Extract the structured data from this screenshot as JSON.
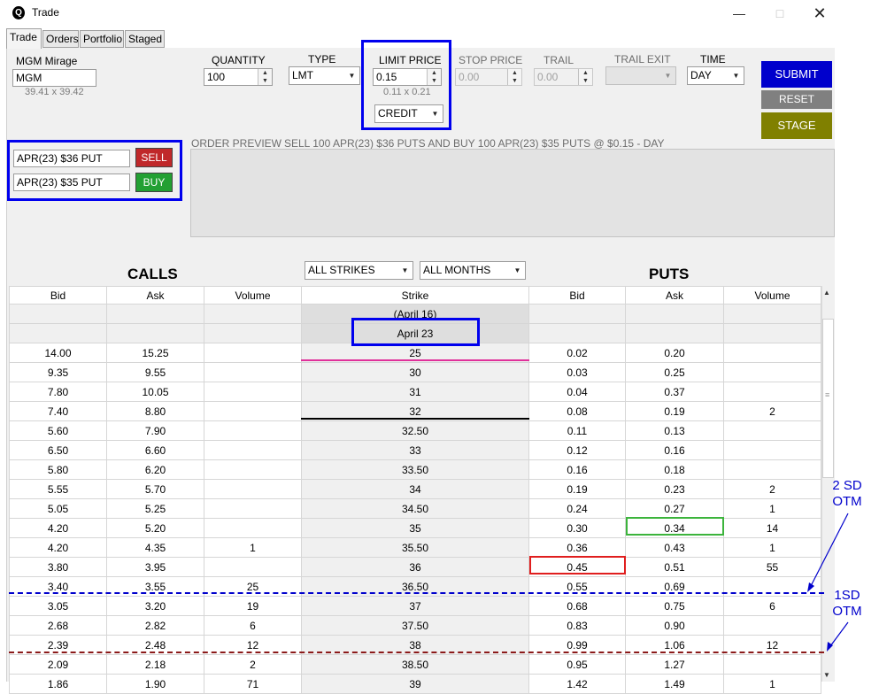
{
  "window": {
    "title": "Trade",
    "app_icon": "Q"
  },
  "tabs": [
    {
      "label": "Trade",
      "active": true
    },
    {
      "label": "Orders",
      "active": false
    },
    {
      "label": "Portfolio",
      "active": false
    },
    {
      "label": "Staged",
      "active": false
    }
  ],
  "symbol": {
    "name": "MGM Mirage",
    "ticker": "MGM",
    "quote": "39.41 x 39.42"
  },
  "order": {
    "quantity_label": "QUANTITY",
    "quantity": "100",
    "type_label": "TYPE",
    "type": "LMT",
    "limit_label": "LIMIT PRICE",
    "limit": "0.15",
    "limit_range": "0.11 x 0.21",
    "credit": "CREDIT",
    "stop_label": "STOP PRICE",
    "stop": "0.00",
    "trail_label": "TRAIL",
    "trail": "0.00",
    "trail_exit_label": "TRAIL EXIT",
    "trail_exit": "",
    "time_label": "TIME",
    "time": "DAY"
  },
  "actions": {
    "submit": "SUBMIT",
    "reset": "RESET",
    "stage": "STAGE",
    "submit_color": "#0000cc",
    "reset_color": "#808080",
    "stage_color": "#808000"
  },
  "legs": [
    {
      "desc": "APR(23) $36 PUT",
      "action": "SELL",
      "color": "#c0282a"
    },
    {
      "desc": "APR(23) $35 PUT",
      "action": "BUY",
      "color": "#23a033"
    }
  ],
  "preview": {
    "label": "ORDER PREVIEW",
    "text": "SELL 100 APR(23) $36 PUTS AND BUY 100 APR(23) $35 PUTS @ $0.15 - DAY"
  },
  "chain": {
    "calls_label": "CALLS",
    "puts_label": "PUTS",
    "strikes_filter": "ALL STRIKES",
    "months_filter": "ALL MONTHS",
    "headers": [
      "Bid",
      "Ask",
      "Volume",
      "Strike",
      "Bid",
      "Ask",
      "Volume"
    ],
    "month_rows": [
      "(April 16)",
      "April 23"
    ],
    "rows": [
      [
        "14.00",
        "15.25",
        "",
        "25",
        "0.02",
        "0.20",
        ""
      ],
      [
        "9.35",
        "9.55",
        "",
        "30",
        "0.03",
        "0.25",
        ""
      ],
      [
        "7.80",
        "10.05",
        "",
        "31",
        "0.04",
        "0.37",
        ""
      ],
      [
        "7.40",
        "8.80",
        "",
        "32",
        "0.08",
        "0.19",
        "2"
      ],
      [
        "5.60",
        "7.90",
        "",
        "32.50",
        "0.11",
        "0.13",
        ""
      ],
      [
        "6.50",
        "6.60",
        "",
        "33",
        "0.12",
        "0.16",
        ""
      ],
      [
        "5.80",
        "6.20",
        "",
        "33.50",
        "0.16",
        "0.18",
        ""
      ],
      [
        "5.55",
        "5.70",
        "",
        "34",
        "0.19",
        "0.23",
        "2"
      ],
      [
        "5.05",
        "5.25",
        "",
        "34.50",
        "0.24",
        "0.27",
        "1"
      ],
      [
        "4.20",
        "5.20",
        "",
        "35",
        "0.30",
        "0.34",
        "14"
      ],
      [
        "4.20",
        "4.35",
        "1",
        "35.50",
        "0.36",
        "0.43",
        "1"
      ],
      [
        "3.80",
        "3.95",
        "",
        "36",
        "0.45",
        "0.51",
        "55"
      ],
      [
        "3.40",
        "3.55",
        "25",
        "36.50",
        "0.55",
        "0.69",
        ""
      ],
      [
        "3.05",
        "3.20",
        "19",
        "37",
        "0.68",
        "0.75",
        "6"
      ],
      [
        "2.68",
        "2.82",
        "6",
        "37.50",
        "0.83",
        "0.90",
        ""
      ],
      [
        "2.39",
        "2.48",
        "12",
        "38",
        "0.99",
        "1.06",
        "12"
      ],
      [
        "2.09",
        "2.18",
        "2",
        "38.50",
        "0.95",
        "1.27",
        ""
      ],
      [
        "1.86",
        "1.90",
        "71",
        "39",
        "1.42",
        "1.49",
        "1"
      ]
    ]
  },
  "annotations": {
    "two_sd": [
      "2 SD",
      "OTM"
    ],
    "one_sd": [
      "1SD",
      "OTM"
    ],
    "color": "#0000cc"
  }
}
